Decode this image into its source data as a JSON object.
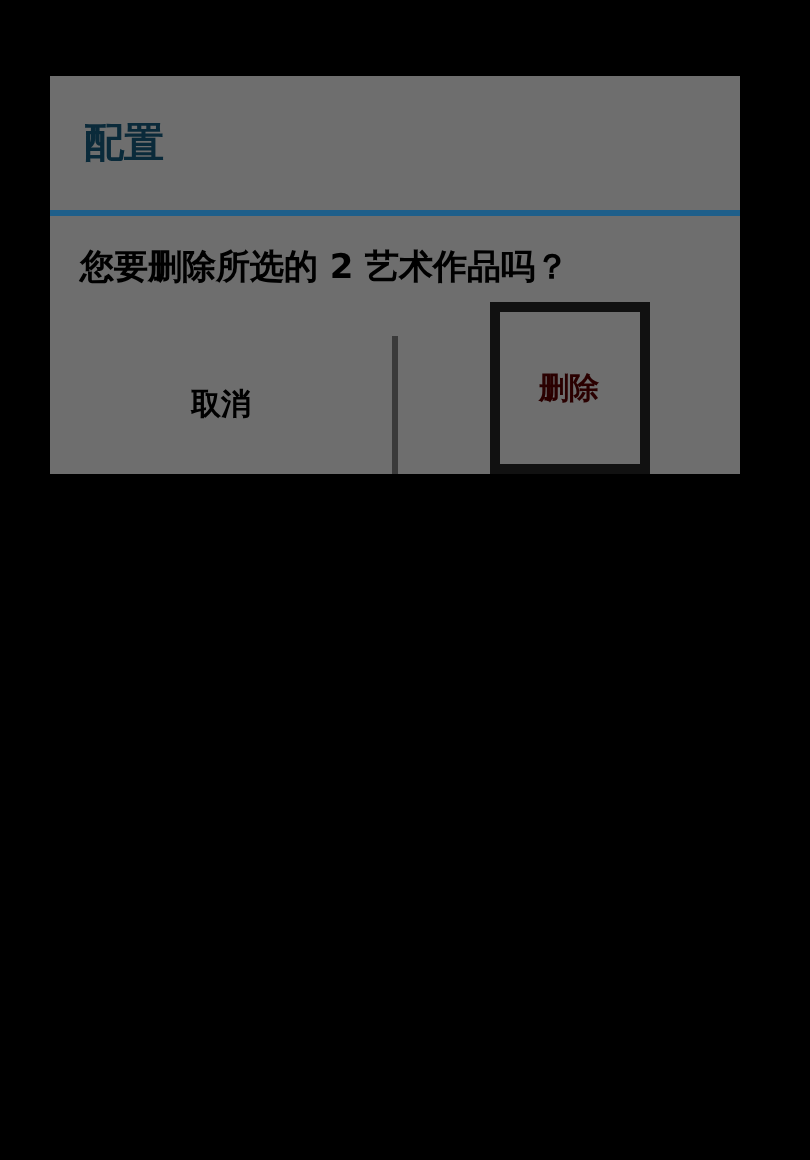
{
  "dialog": {
    "title": "配置",
    "message": "您要删除所选的 2 艺术作品吗？",
    "buttons": [
      {
        "label": "取消",
        "kind": "cancel",
        "focused": false
      },
      {
        "label": "删除",
        "kind": "destructive",
        "focused": true
      }
    ]
  }
}
